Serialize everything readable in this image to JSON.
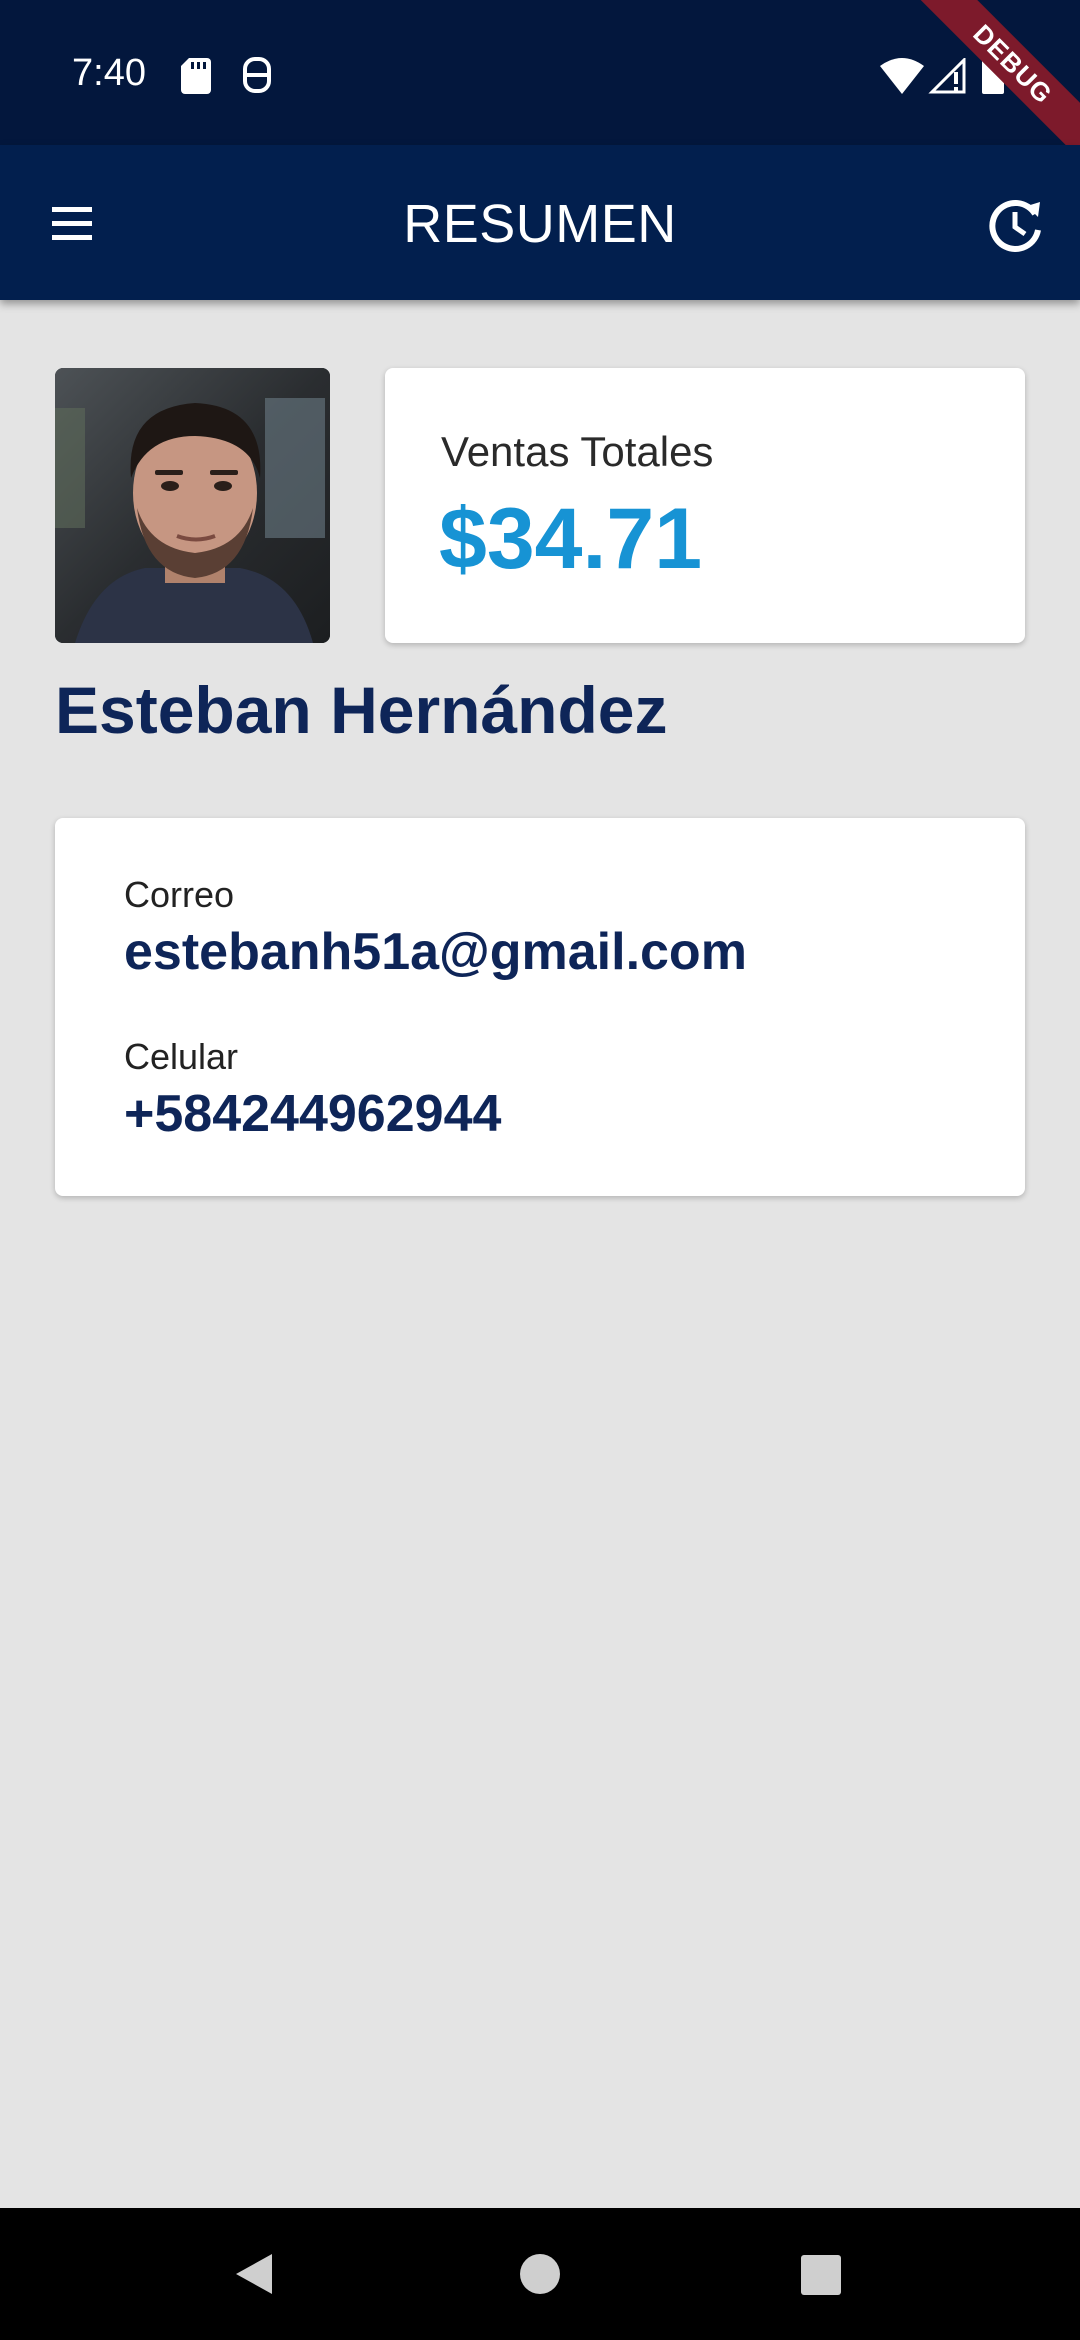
{
  "status_bar": {
    "time": "7:40",
    "icons": [
      "sd-card-icon",
      "shield-icon",
      "wifi-icon",
      "signal-icon",
      "battery-icon"
    ]
  },
  "debug_banner": "DEBUG",
  "app_bar": {
    "title": "RESUMEN",
    "menu_icon": "menu-icon",
    "history_icon": "history-icon"
  },
  "sales": {
    "label": "Ventas Totales",
    "value": "$34.71"
  },
  "user": {
    "name": "Esteban Hernández"
  },
  "contact": {
    "email_label": "Correo",
    "email_value": "estebanh51a@gmail.com",
    "phone_label": "Celular",
    "phone_value": "+584244962944"
  },
  "nav_bar": {
    "icons": [
      "back-icon",
      "home-icon",
      "recents-icon"
    ]
  },
  "colors": {
    "status_bar": "#03173d",
    "app_bar": "#021f4e",
    "background": "#e4e4e4",
    "accent": "#1793d4",
    "text_primary": "#0e2558",
    "debug_ribbon": "#7d1a2b"
  }
}
